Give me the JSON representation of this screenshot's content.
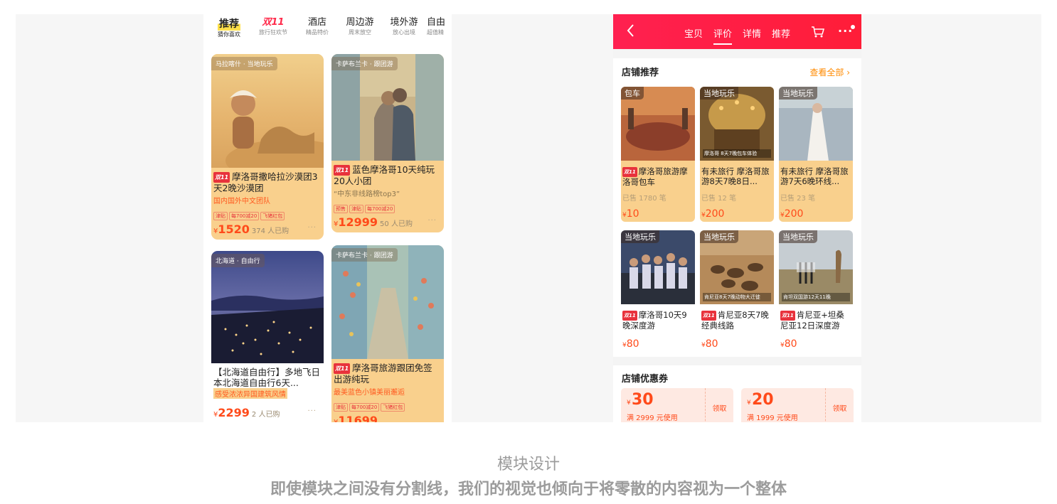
{
  "left": {
    "tabs": [
      {
        "label": "推荐",
        "sub": "猜你喜欢"
      },
      {
        "label": "双11",
        "sub": "旅行狂欢节"
      },
      {
        "label": "酒店",
        "sub": "精品特价"
      },
      {
        "label": "周边游",
        "sub": "周末放空"
      },
      {
        "label": "境外游",
        "sub": "放心出境"
      },
      {
        "label": "自由",
        "sub": "超值精"
      }
    ],
    "cards": [
      {
        "tag": "马拉喀什 · 当地玩乐",
        "badge": "双11",
        "title": "摩洛哥撒哈拉沙漠团3天2晚沙漠团",
        "sub": "国内国外中文团队",
        "chips": [
          "津贴",
          "每700减20",
          "飞猪红包"
        ],
        "yen": "¥",
        "price": "1520",
        "sold": "374 人已购",
        "more": "···"
      },
      {
        "tag": "卡萨布兰卡 · 跟团游",
        "badge": "双11",
        "title": "蓝色摩洛哥10天纯玩20人小团",
        "sub": "“中东非线路榜top3”",
        "chips": [
          "预售",
          "津贴",
          "每700减20"
        ],
        "yen": "¥",
        "price": "12999",
        "sold": "50 人已购",
        "more": "···"
      },
      {
        "tag": "北海道 · 自由行",
        "badge": "",
        "title": "【北海道自由行】多地飞日本北海道自由行6天...",
        "sub": "感受浓浓异国建筑风情",
        "chips": [],
        "yen": "¥",
        "price": "2299",
        "sold": "2 人已购",
        "more": "···"
      },
      {
        "tag": "卡萨布兰卡 · 跟团游",
        "badge": "双11",
        "title": "摩洛哥旅游跟团免签出游纯玩",
        "sub": "最美蓝色小镇美丽邂逅",
        "chips": [
          "津贴",
          "每700减20",
          "飞猪红包"
        ],
        "yen": "¥",
        "price": "11699",
        "sold": "",
        "more": ""
      }
    ]
  },
  "right": {
    "nav": {
      "tab1": "宝贝",
      "tab2": "评价",
      "tab3": "详情",
      "tab4": "推荐",
      "more": "···"
    },
    "shop": {
      "title": "店铺推荐",
      "see_all": "查看全部",
      "items": [
        {
          "tag": "包车",
          "caption": "",
          "badge": "双11",
          "title": "摩洛哥旅游摩洛哥包车",
          "sold": "已售 1780 笔",
          "yen": "¥",
          "price": "10"
        },
        {
          "tag": "当地玩乐",
          "caption": "摩洛哥 8天7晚包车体验",
          "badge": "",
          "title": "有未旅行 摩洛哥旅游8天7晚8日...",
          "sold": "已售 12 笔",
          "yen": "¥",
          "price": "200"
        },
        {
          "tag": "当地玩乐",
          "caption": "",
          "badge": "",
          "title": "有未旅行 摩洛哥旅游7天6晚环线...",
          "sold": "已售 23 笔",
          "yen": "¥",
          "price": "200"
        },
        {
          "tag": "当地玩乐",
          "caption": "",
          "badge": "双11",
          "title": "摩洛哥10天9晚深度游",
          "sold": "",
          "yen": "¥",
          "price": "80"
        },
        {
          "tag": "当地玩乐",
          "caption": "肯尼亚8天7晚动物大迁徙",
          "badge": "双11",
          "title": "肯尼亚8天7晚经典线路",
          "sold": "",
          "yen": "¥",
          "price": "80"
        },
        {
          "tag": "当地玩乐",
          "caption": "肯坦双国游12天11晚",
          "badge": "双11",
          "title": "肯尼亚+坦桑尼亚12日深度游",
          "sold": "",
          "yen": "¥",
          "price": "80"
        }
      ]
    },
    "coupons": {
      "title": "店铺优惠券",
      "items": [
        {
          "yen": "¥",
          "value": "30",
          "cond": "满 2999 元使用",
          "action": "领取"
        },
        {
          "yen": "¥",
          "value": "20",
          "cond": "满 1999 元使用",
          "action": "领取"
        }
      ]
    }
  },
  "caption": {
    "title": "模块设计",
    "subtitle": "即使模块之间没有分割线，我们的视觉也倾向于将零散的内容视为一个整体"
  },
  "colors": {
    "brand_red": "#ff1d38",
    "price_orange": "#ff4a1a",
    "card_highlight": "#f9d08d",
    "link_orange": "#ff8a00"
  }
}
